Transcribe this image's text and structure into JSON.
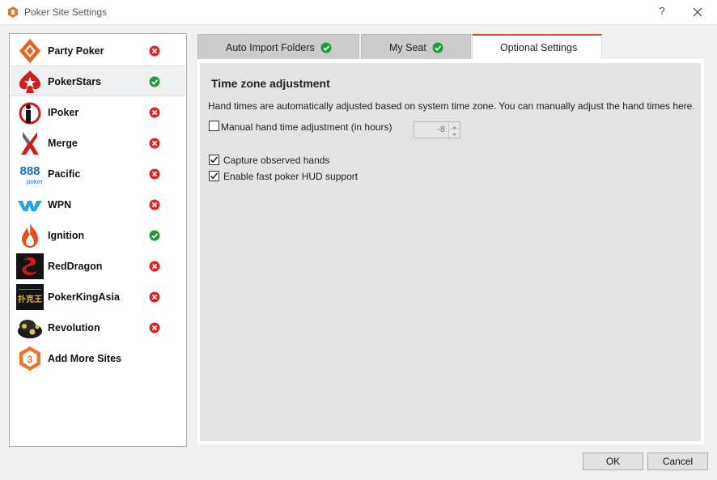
{
  "window": {
    "title": "Poker Site Settings",
    "help_label": "?"
  },
  "sites": [
    {
      "name": "Party Poker",
      "status": "error",
      "logo": "party-poker-logo"
    },
    {
      "name": "PokerStars",
      "status": "ok",
      "logo": "pokerstars-logo"
    },
    {
      "name": "IPoker",
      "status": "error",
      "logo": "ipoker-logo"
    },
    {
      "name": "Merge",
      "status": "error",
      "logo": "merge-logo"
    },
    {
      "name": "Pacific",
      "status": "error",
      "logo": "888-poker-logo",
      "logo_text": "888",
      "logo_subtext": "poker"
    },
    {
      "name": "WPN",
      "status": "error",
      "logo": "wpn-logo"
    },
    {
      "name": "Ignition",
      "status": "ok",
      "logo": "ignition-logo"
    },
    {
      "name": "RedDragon",
      "status": "error",
      "logo": "reddragon-logo"
    },
    {
      "name": "PokerKingAsia",
      "status": "error",
      "logo": "pokerkingasia-logo",
      "logo_text": "扑克王"
    },
    {
      "name": "Revolution",
      "status": "error",
      "logo": "revolution-logo"
    },
    {
      "name": "Add More Sites",
      "status": "",
      "logo": "add-sites-logo",
      "logo_text": "3"
    }
  ],
  "tabs": [
    {
      "label": "Auto Import Folders",
      "complete": true
    },
    {
      "label": "My Seat",
      "complete": true
    },
    {
      "label": "Optional Settings",
      "complete": false,
      "active": true
    }
  ],
  "optional_settings": {
    "section_title": "Time zone adjustment",
    "description": "Hand times are automatically adjusted based on system time zone.  You can manually adjust the hand times here.",
    "manual_adjust": {
      "label": "Manual hand time adjustment (in hours)",
      "checked": false,
      "value": "-8"
    },
    "capture_observed": {
      "label": "Capture observed hands",
      "checked": true
    },
    "fast_hud": {
      "label": "Enable fast poker HUD support",
      "checked": true
    }
  },
  "buttons": {
    "ok": "OK",
    "cancel": "Cancel"
  },
  "colors": {
    "ok_status": "#1e9a3a",
    "error_status": "#e02424",
    "active_tab_accent": "#c8502a"
  }
}
